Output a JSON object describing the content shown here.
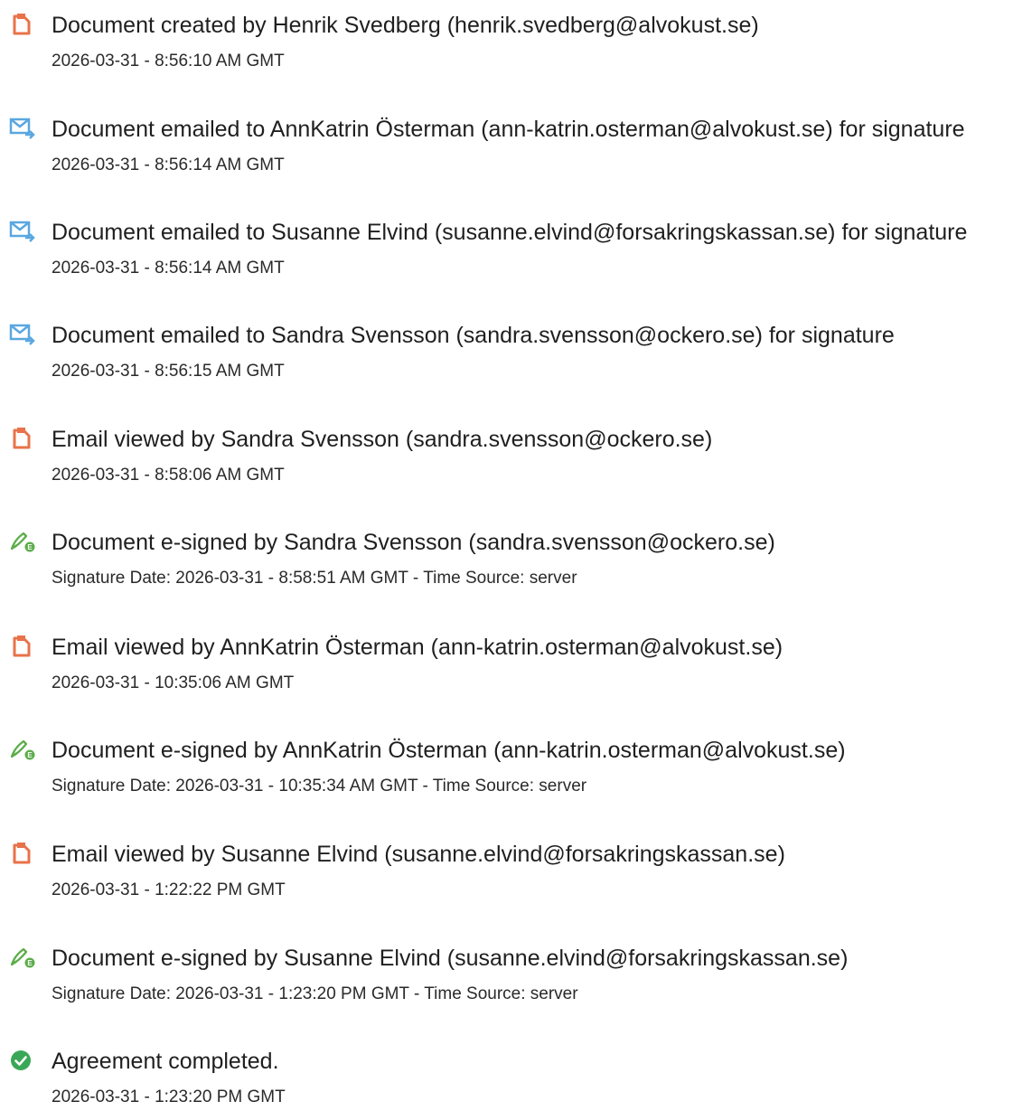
{
  "events": [
    {
      "icon": "document-icon",
      "title": "Document created by Henrik Svedberg (henrik.svedberg@alvokust.se)",
      "meta": "2026-03-31 - 8:56:10 AM GMT"
    },
    {
      "icon": "email-sent-icon",
      "title": "Document emailed to AnnKatrin Österman (ann-katrin.osterman@alvokust.se) for signature",
      "meta": "2026-03-31 - 8:56:14 AM GMT"
    },
    {
      "icon": "email-sent-icon",
      "title": "Document emailed to Susanne Elvind (susanne.elvind@forsakringskassan.se) for signature",
      "meta": "2026-03-31 - 8:56:14 AM GMT"
    },
    {
      "icon": "email-sent-icon",
      "title": "Document emailed to Sandra Svensson (sandra.svensson@ockero.se) for signature",
      "meta": "2026-03-31 - 8:56:15 AM GMT"
    },
    {
      "icon": "document-icon",
      "title": "Email viewed by Sandra Svensson (sandra.svensson@ockero.se)",
      "meta": "2026-03-31 - 8:58:06 AM GMT"
    },
    {
      "icon": "e-sign-pen-icon",
      "title": "Document e-signed by Sandra Svensson (sandra.svensson@ockero.se)",
      "meta": "Signature Date: 2026-03-31 - 8:58:51 AM GMT - Time Source: server"
    },
    {
      "icon": "document-icon",
      "title": "Email viewed by AnnKatrin Österman (ann-katrin.osterman@alvokust.se)",
      "meta": "2026-03-31 - 10:35:06 AM GMT"
    },
    {
      "icon": "e-sign-pen-icon",
      "title": "Document e-signed by AnnKatrin Österman (ann-katrin.osterman@alvokust.se)",
      "meta": "Signature Date: 2026-03-31 - 10:35:34 AM GMT - Time Source: server"
    },
    {
      "icon": "document-icon",
      "title": "Email viewed by Susanne Elvind (susanne.elvind@forsakringskassan.se)",
      "meta": "2026-03-31 - 1:22:22 PM GMT"
    },
    {
      "icon": "e-sign-pen-icon",
      "title": "Document e-signed by Susanne Elvind (susanne.elvind@forsakringskassan.se)",
      "meta": "Signature Date: 2026-03-31 - 1:23:20 PM GMT - Time Source: server"
    },
    {
      "icon": "check-circle-icon",
      "title": "Agreement completed.",
      "meta": "2026-03-31 - 1:23:20 PM GMT"
    }
  ],
  "colors": {
    "document_icon": "#e8734a",
    "email_icon": "#5aa7e0",
    "sign_icon": "#5cae4a",
    "check_icon": "#3aa757"
  }
}
